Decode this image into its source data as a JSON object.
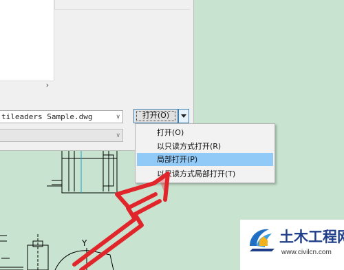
{
  "dialog": {
    "filename": "tileaders Sample.dwg",
    "open_button_label": "打开(O)",
    "scroll_arrow": "›"
  },
  "menu": {
    "items": [
      {
        "label": "打开(O)",
        "highlighted": false
      },
      {
        "label": "以只读方式打开(R)",
        "highlighted": false
      },
      {
        "label": "局部打开(P)",
        "highlighted": true
      },
      {
        "label": "以只读方式局部打开(T)",
        "highlighted": false
      }
    ]
  },
  "drawing": {
    "axis_label": "Y"
  },
  "watermark": {
    "title": "土木工程网",
    "url": "www.civilcn.com"
  },
  "colors": {
    "canvas": "#c8e3cf",
    "menu_highlight": "#91c9f7",
    "arrow": "#e0262b",
    "watermark_text": "#1f3e8a"
  }
}
